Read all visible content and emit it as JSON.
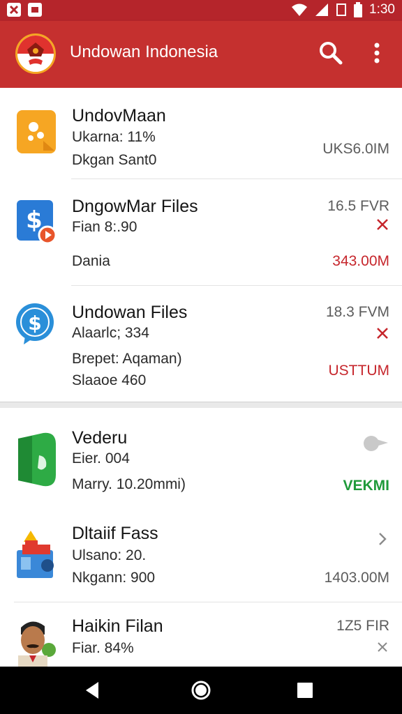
{
  "status_bar": {
    "time": "1:30"
  },
  "app_bar": {
    "title": "Undowan Indonesia"
  },
  "items": [
    {
      "title": "UndovMaan",
      "line1": "Ukarna: 11%",
      "line2": "Dkgan Sant0",
      "right": "UKS6.0IM"
    },
    {
      "title": "DngowMar Files",
      "line1": "Fian 8:.90",
      "line2": "Dania",
      "right_top": "16.5 FVR",
      "right_bottom": "343.00M"
    },
    {
      "title": "Undowan Files",
      "line1": "Alaarlc; 334",
      "line2": "Brepet: Aqaman)",
      "line3": "Slaaoe 460",
      "right_top": "18.3 FVM",
      "right_bottom": "USTTUM"
    },
    {
      "title": "Vederu",
      "line1": "Eier. 004",
      "line2": "Marry. 10.20mmi)",
      "right_bottom": "VEKMI"
    },
    {
      "title": "Dltaiif Fass",
      "line1": "Ulsano: 20.",
      "line2": "Nkgann: 900",
      "right_bottom": "1403.00M"
    },
    {
      "title": "Haikin Filan",
      "line1": "Fiar. 84%",
      "right_top": "1Z5 FIR"
    }
  ],
  "colors": {
    "primary": "#c5302f",
    "status": "#b5252b",
    "danger": "#c6262c",
    "success": "#1f9a3a"
  },
  "icons": [
    "app-logo-icon",
    "search-icon",
    "more-vert-icon",
    "close-icon",
    "chevron-right-icon",
    "toggle-icon",
    "back-icon",
    "home-icon",
    "recents-icon"
  ]
}
